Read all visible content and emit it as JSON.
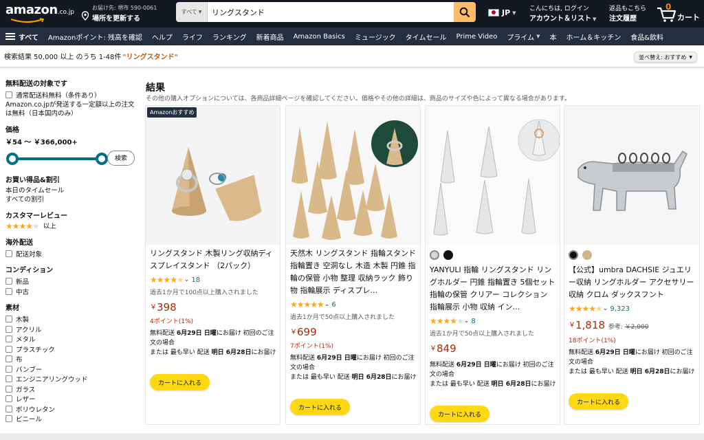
{
  "header": {
    "logo_text": "amazon",
    "logo_domain": ".co.jp",
    "deliver_line1": "お届け先: 堺市 590-0061",
    "deliver_line2": "場所を更新する",
    "search_category": "すべて",
    "search_value": "リングスタンド",
    "language": "JP",
    "account_line1": "こんにちは, ログイン",
    "account_line2": "アカウント＆リスト",
    "orders_line1": "返品もこちら",
    "orders_line2": "注文履歴",
    "cart_count": "0",
    "cart_label": "カート"
  },
  "nav": {
    "all_label": "すべて",
    "items": [
      "Amazonポイント: 残高を確認",
      "ヘルプ",
      "ライフ",
      "ランキング",
      "新着商品",
      "Amazon Basics",
      "ミュージック",
      "タイムセール",
      "Prime Video",
      "プライム",
      "本",
      "ホーム＆キッチン",
      "食品&飲料"
    ]
  },
  "results_bar": {
    "text": "検索結果 50,000 以上 のうち 1-48件",
    "query": "\"リングスタンド\"",
    "sort_label": "並べ替え: おすすめ"
  },
  "sidebar": {
    "shipping_heading": "無料配送の対象です",
    "shipping_option": "通常配送料無料（条件あり）",
    "shipping_note": "Amazon.co.jpが発送する一定額以上の注文は無料（日本国内のみ）",
    "price_heading": "価格",
    "price_range": "￥54 ～ ￥366,000+",
    "price_min_pct": 0,
    "price_max_pct": 100,
    "search_button": "検索",
    "deals_heading": "お買い得品&割引",
    "deals_items": [
      "本日のタイムセール",
      "すべての割引"
    ],
    "review_heading": "カスタマーレビュー",
    "review_stars": 4,
    "review_suffix": "以上",
    "overseas_heading": "海外配送",
    "overseas_option": "配送対象",
    "condition_heading": "コンディション",
    "condition_options": [
      "新品",
      "中古"
    ],
    "material_heading": "素材",
    "material_options": [
      "木製",
      "アクリル",
      "メタル",
      "プラスチック",
      "布",
      "バンブー",
      "エンジニアリングウッド",
      "ガラス",
      "レザー",
      "ポリウレタン",
      "ビニール"
    ]
  },
  "results": {
    "title": "結果",
    "note": "その他の購入オプションについては、各商品詳細ページを確認してください。価格やその他の詳細は、商品のサイズや色によって異なる場合があります。"
  },
  "products": [
    {
      "badge": "Amazonおすすめ",
      "title": "リングスタンド 木製リング収納ディスプレイスタンド （2パック）",
      "rating": 4.5,
      "reviews": "18",
      "bought": "過去1か月で100点以上購入されました",
      "price": "398",
      "points": "4ポイント(1%)",
      "delivery_free": "無料配送",
      "delivery_date": "6月29日 日曜",
      "delivery_tail": "にお届け 初回のご注文の場合",
      "fast_prefix": "または 最も早い 配送",
      "fast_date": "明日 6月28日",
      "fast_tail": "にお届け",
      "cart_button": "カートに入れる"
    },
    {
      "title": "天然木 リングスタンド 指輪スタンド 指輪置き 空洞なし 木造 木製 円錐 指輪の保管 小物 整理 収納ラック 飾り物 指輪展示 ディスプレ…",
      "rating": 5,
      "reviews": "6",
      "bought": "過去1か月で50点以上購入されました",
      "price": "699",
      "points": "7ポイント(1%)",
      "delivery_free": "無料配送",
      "delivery_date": "6月29日 日曜",
      "delivery_tail": "にお届け 初回のご注文の場合",
      "fast_prefix": "または 最も早い 配送",
      "fast_date": "明日 6月28日",
      "fast_tail": "にお届け",
      "cart_button": "カートに入れる"
    },
    {
      "title": "YANYULI 指輪 リングスタンド リングホルダー 円錐 指輪置き 5個セット 指輪の保管 クリアー コレクション 指輪展示 小物 収納 イン…",
      "rating": 4,
      "reviews": "8",
      "bought": "過去1か月で50点以上購入されました",
      "price": "849",
      "delivery_free": "無料配送",
      "delivery_date": "6月29日 日曜",
      "delivery_tail": "にお届け 初回のご注文の場合",
      "fast_prefix": "または 最も早い 配送",
      "fast_date": "明日 6月28日",
      "fast_tail": "にお届け",
      "cart_button": "カートに入れる"
    },
    {
      "title": "【公式】umbra DACHSIE ジュエリー収納 リングホルダー アクセサリー収納 クロム ダックスフント",
      "rating": 4.5,
      "reviews": "9,323",
      "price": "1,818",
      "ref_label": "参考:",
      "ref_price": "￥2,000",
      "points": "18ポイント(1%)",
      "delivery_free": "無料配送",
      "delivery_date": "6月29日 日曜",
      "delivery_tail": "にお届け 初回のご注文の場合",
      "fast_prefix": "または 最も早い 配送",
      "fast_date": "明日 6月28日",
      "fast_tail": "にお届け",
      "cart_button": "カートに入れる"
    }
  ],
  "colors": {
    "header_bg": "#131921",
    "nav_bg": "#232f3e",
    "search_button": "#febd69",
    "accent_link": "#007185",
    "price": "#b12704",
    "cart_button": "#ffd814",
    "star": "#ffa41c"
  }
}
